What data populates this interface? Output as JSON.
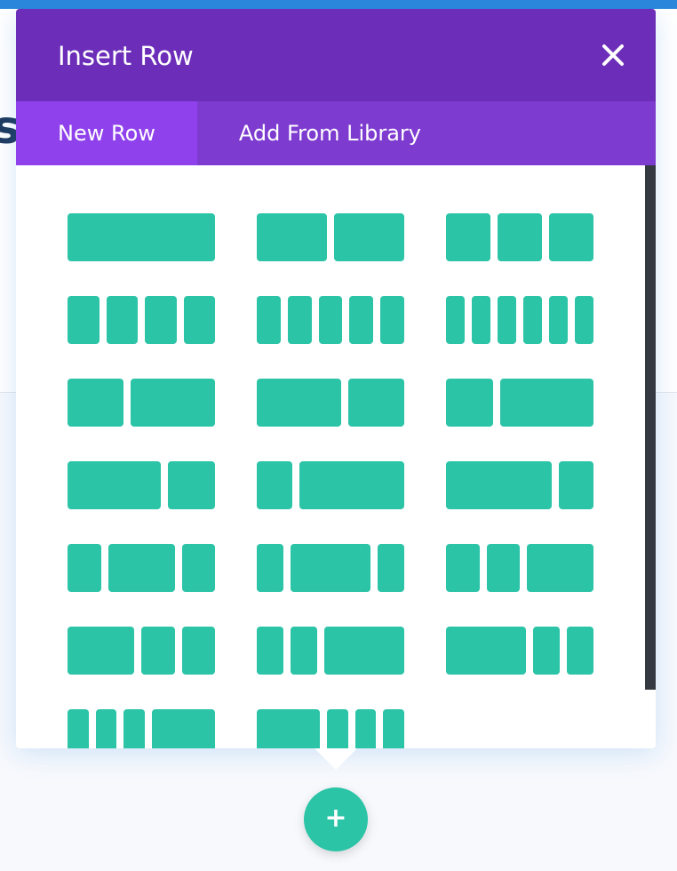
{
  "background": {
    "partial_heading": "s"
  },
  "modal": {
    "title": "Insert Row",
    "close_icon": "close-icon",
    "tabs": [
      {
        "label": "New Row",
        "active": true
      },
      {
        "label": "Add From Library",
        "active": false
      }
    ],
    "accent_color": "#2bc4a7",
    "layouts": [
      [
        [
          1
        ],
        [
          1,
          1
        ],
        [
          1,
          1,
          1
        ]
      ],
      [
        [
          1,
          1,
          1,
          1
        ],
        [
          1,
          1,
          1,
          1,
          1
        ],
        [
          1,
          1,
          1,
          1,
          1,
          1
        ]
      ],
      [
        [
          2,
          3
        ],
        [
          3,
          2
        ],
        [
          1,
          2
        ]
      ],
      [
        [
          2,
          1
        ],
        [
          1,
          3
        ],
        [
          3,
          1
        ]
      ],
      [
        [
          1,
          2,
          1
        ],
        [
          1,
          3,
          1
        ],
        [
          1,
          1,
          2
        ]
      ],
      [
        [
          2,
          1,
          1
        ],
        [
          1,
          1,
          3
        ],
        [
          3,
          1,
          1
        ]
      ],
      [
        [
          1,
          1,
          1,
          3
        ],
        [
          3,
          1,
          1,
          1
        ]
      ]
    ]
  },
  "add_button": {
    "label": "+"
  }
}
